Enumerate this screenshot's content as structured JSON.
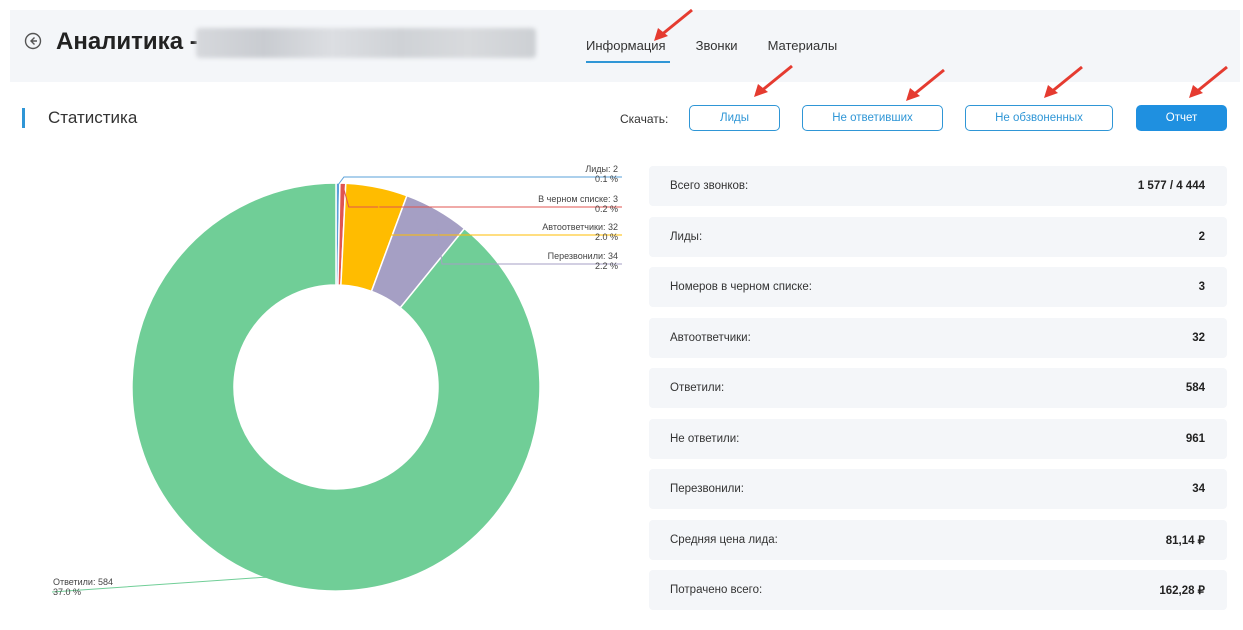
{
  "header": {
    "title": "Аналитика -",
    "tabs": [
      {
        "label": "Информация",
        "active": true
      },
      {
        "label": "Звонки",
        "active": false
      },
      {
        "label": "Материалы",
        "active": false
      }
    ]
  },
  "section": {
    "title": "Статистика",
    "download_label": "Скачать:",
    "buttons": [
      "Лиды",
      "Не ответивших",
      "Не обзвоненных",
      "Отчет"
    ]
  },
  "colors": {
    "accent": "#1f90e0",
    "answered": "#70ce97",
    "callback": "#a59fc4",
    "autoanswer": "#ffbc00",
    "blacklist": "#e05550",
    "leads": "#5aa0d8",
    "annotation_arrow": "#e53b30"
  },
  "chart_data": {
    "type": "donut",
    "slices": [
      {
        "label": "Лиды: 2",
        "percent_label": "0.1 %",
        "value": 2,
        "color": "#5aa0d8"
      },
      {
        "label": "В черном списке: 3",
        "percent_label": "0.2 %",
        "value": 3,
        "color": "#e05550"
      },
      {
        "label": "Автоответчики: 32",
        "percent_label": "2.0 %",
        "value": 32,
        "color": "#ffbc00"
      },
      {
        "label": "Перезвонили: 34",
        "percent_label": "2.2 %",
        "value": 34,
        "color": "#a59fc4"
      },
      {
        "label": "Ответили: 584",
        "percent_label": "37.0 %",
        "value": 584,
        "color": "#70ce97"
      }
    ]
  },
  "stats": [
    {
      "label": "Всего звонков:",
      "value": "1 577 / 4 444"
    },
    {
      "label": "Лиды:",
      "value": "2"
    },
    {
      "label": "Номеров в черном списке:",
      "value": "3"
    },
    {
      "label": "Автоответчики:",
      "value": "32"
    },
    {
      "label": "Ответили:",
      "value": "584"
    },
    {
      "label": "Не ответили:",
      "value": "961"
    },
    {
      "label": "Перезвонили:",
      "value": "34"
    },
    {
      "label": "Средняя цена лида:",
      "value": "81,14 ₽"
    },
    {
      "label": "Потрачено всего:",
      "value": "162,28 ₽"
    }
  ]
}
